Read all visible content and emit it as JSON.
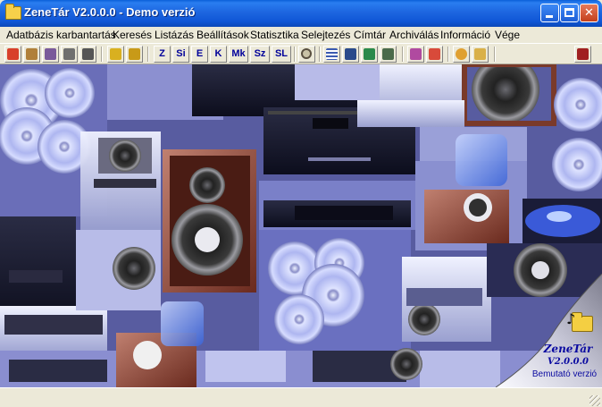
{
  "window": {
    "title": "ZeneTár V2.0.0.0 - Demo verzió",
    "icon": "folder-icon",
    "controls": [
      "minimize-icon",
      "maximize-icon",
      "close-icon"
    ],
    "colors": {
      "titlebar": "#1d66e0",
      "close": "#c4401c"
    }
  },
  "menu": {
    "items": [
      {
        "label": "Adatbázis karbantartás"
      },
      {
        "label": "Keresés"
      },
      {
        "label": "Listázás"
      },
      {
        "label": "Beállítások"
      },
      {
        "label": "Statisztika"
      },
      {
        "label": "Selejtezés"
      },
      {
        "label": "Címtár"
      },
      {
        "label": "Archiválás"
      },
      {
        "label": "Információ"
      },
      {
        "label": "Vége"
      }
    ]
  },
  "toolbar": {
    "icon_buttons": [
      {
        "icon": "new-record-icon"
      },
      {
        "icon": "edit-record-icon"
      },
      {
        "icon": "wand-icon"
      },
      {
        "icon": "delete-icon"
      },
      {
        "icon": "trash-icon"
      },
      {
        "icon": "copy-icon"
      },
      {
        "icon": "paste-icon"
      }
    ],
    "text_buttons": [
      {
        "label": "Z"
      },
      {
        "label": "Si"
      },
      {
        "label": "E"
      },
      {
        "label": "K"
      },
      {
        "label": "Mk"
      },
      {
        "label": "Sz"
      },
      {
        "label": "SL"
      }
    ],
    "tool_buttons": [
      {
        "icon": "search-icon"
      },
      {
        "icon": "table-icon"
      },
      {
        "icon": "transfer-icon"
      },
      {
        "icon": "runner-icon"
      },
      {
        "icon": "network-icon"
      },
      {
        "icon": "sort-icon"
      },
      {
        "icon": "help-icon"
      },
      {
        "icon": "people-icon"
      },
      {
        "icon": "user-icon"
      },
      {
        "icon": "exit-door-icon"
      }
    ]
  },
  "splash": {
    "brand": "ZeneTár",
    "version": "V2.0.0.0",
    "subtitle": "Bemutató verzió",
    "icon": "music-folder-icon"
  }
}
